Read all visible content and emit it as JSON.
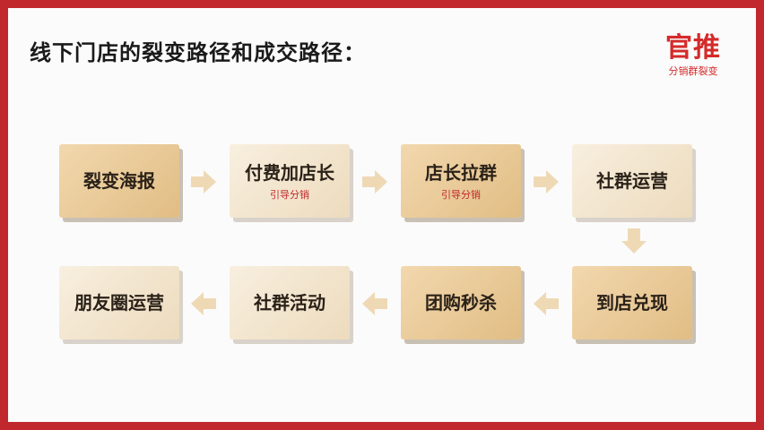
{
  "title": "线下门店的裂变路径和成交路径：",
  "logo": {
    "main": "官推",
    "sub": "分销群裂变"
  },
  "colors": {
    "frame": "#c0282d",
    "box_dark": "#e7c894",
    "box_light": "#f3e6cf",
    "arrow": "#efd9b5",
    "accent_text": "#c0282d"
  },
  "flow": {
    "row1": [
      {
        "label": "裂变海报",
        "sub": ""
      },
      {
        "label": "付费加店长",
        "sub": "引导分销"
      },
      {
        "label": "店长拉群",
        "sub": "引导分销"
      },
      {
        "label": "社群运营",
        "sub": ""
      }
    ],
    "row2": [
      {
        "label": "朋友圈运营"
      },
      {
        "label": "社群活动"
      },
      {
        "label": "团购秒杀"
      },
      {
        "label": "到店兑现"
      }
    ]
  }
}
